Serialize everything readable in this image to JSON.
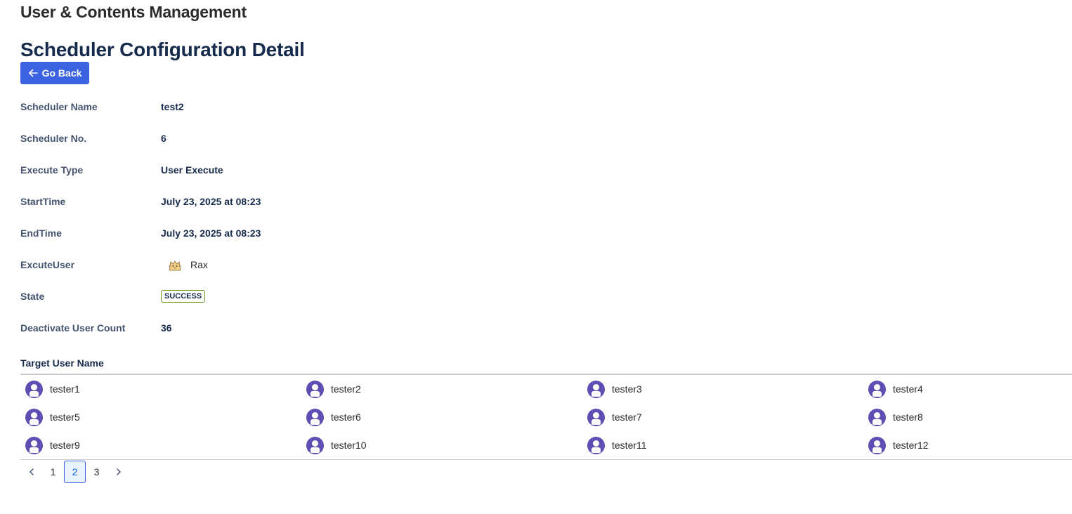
{
  "app": {
    "title": "User & Contents Management"
  },
  "page": {
    "title": "Scheduler Configuration Detail"
  },
  "back_button": {
    "label": "Go Back",
    "icon": "arrow-left-icon"
  },
  "details": [
    {
      "label": "Scheduler Name",
      "value": "test2"
    },
    {
      "label": "Scheduler No.",
      "value": "6"
    },
    {
      "label": "Execute Type",
      "value": "User Execute"
    },
    {
      "label": "StartTime",
      "value": "July 23, 2025 at 08:23"
    },
    {
      "label": "EndTime",
      "value": "July 23, 2025 at 08:23"
    },
    {
      "label": "ExcuteUser",
      "value": "Rax",
      "icon": "user-avatar-cat-icon"
    },
    {
      "label": "State",
      "value": "SUCCESS",
      "status_color": "#6a9a23"
    },
    {
      "label": "Deactivate User Count",
      "value": "36"
    }
  ],
  "target_users": {
    "heading": "Target User Name",
    "avatar_color": "#5e4db2",
    "users": [
      "tester1",
      "tester2",
      "tester3",
      "tester4",
      "tester5",
      "tester6",
      "tester7",
      "tester8",
      "tester9",
      "tester10",
      "tester11",
      "tester12"
    ]
  },
  "pagination": {
    "pages": [
      "1",
      "2",
      "3"
    ],
    "current": "2",
    "prev_icon": "chevron-left-icon",
    "next_icon": "chevron-right-icon"
  },
  "colors": {
    "accent": "#3b62e0",
    "title": "#172b4d"
  }
}
